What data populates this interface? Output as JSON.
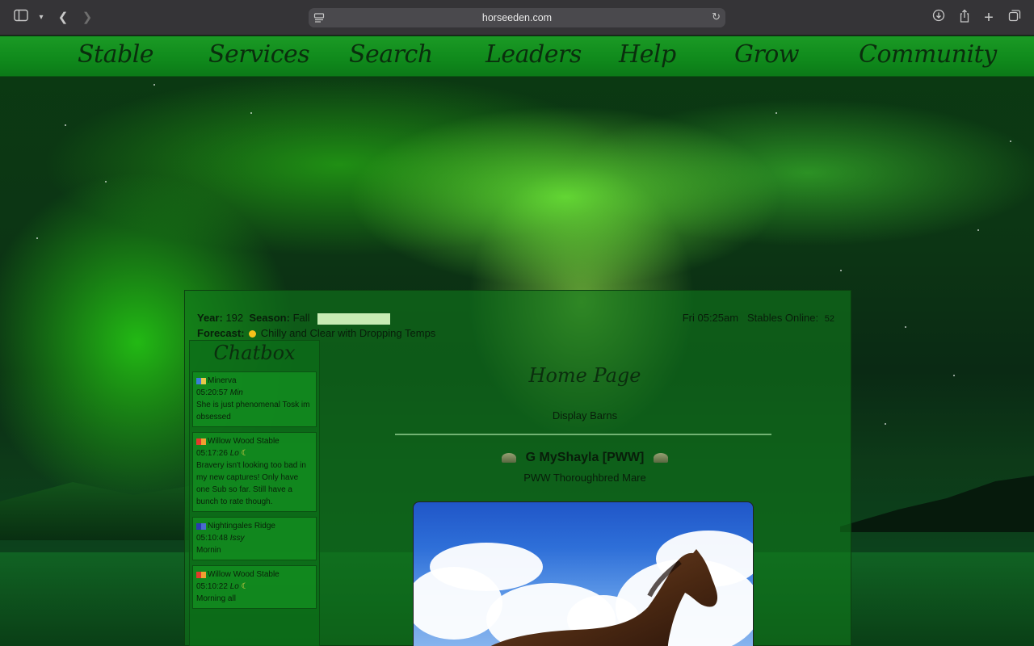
{
  "browser": {
    "url": "horseeden.com"
  },
  "nav": {
    "items": [
      "Stable",
      "Services",
      "Search",
      "Leaders",
      "Help",
      "Grow",
      "Community"
    ]
  },
  "status": {
    "year_label": "Year:",
    "year": "192",
    "season_label": "Season:",
    "season": "Fall",
    "forecast_label": "Forecast:",
    "forecast": "Chilly and Clear with Dropping Temps",
    "time": "Fri 05:25am",
    "online_label": "Stables Online:",
    "online": "52"
  },
  "chatbox": {
    "title": "Chatbox",
    "messages": [
      {
        "stable": "Minerva",
        "time": "05:20:57",
        "user": "Min",
        "moon": false,
        "text": "She is just phenomenal Tosk im obsessed",
        "flag": [
          "#3a7dd8",
          "#e6c84a"
        ]
      },
      {
        "stable": "Willow Wood Stable",
        "time": "05:17:26",
        "user": "Lo",
        "moon": true,
        "text": "Bravery isn't looking too bad in my new captures! Only have one Sub so far. Still have a bunch to rate though.",
        "flag": [
          "#e23a2a",
          "#f0a030"
        ]
      },
      {
        "stable": "Nightingales Ridge",
        "time": "05:10:48",
        "user": "Issy",
        "moon": false,
        "text": "Mornin",
        "flag": [
          "#2a3ab0",
          "#4a6ad0"
        ]
      },
      {
        "stable": "Willow Wood Stable",
        "time": "05:10:22",
        "user": "Lo",
        "moon": true,
        "text": "Morning all",
        "flag": [
          "#e23a2a",
          "#f0a030"
        ]
      }
    ]
  },
  "main": {
    "page_title": "Home Page",
    "display_barns": "Display Barns",
    "horse_icon": "G",
    "horse_name": "MyShayla [PWW]",
    "horse_breed": "PWW Thoroughbred Mare"
  },
  "colors": {
    "nav_green": "#1b9a25",
    "panel_green": "#107a1c",
    "text_dark": "#081e0a"
  }
}
